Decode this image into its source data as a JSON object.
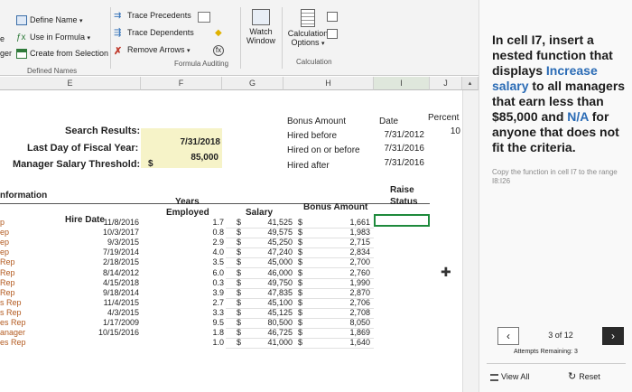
{
  "ribbon": {
    "define_name": "Define Name",
    "use_in_formula": "Use in Formula",
    "create_from_selection": "Create from Selection",
    "defined_names_group": "Defined Names",
    "trace_precedents": "Trace Precedents",
    "trace_dependents": "Trace Dependents",
    "remove_arrows": "Remove Arrows",
    "formula_auditing_group": "Formula Auditing",
    "watch_window_line1": "Watch",
    "watch_window_line2": "Window",
    "calc_options_line1": "Calculation",
    "calc_options_line2": "Options",
    "calculation_group": "Calculation",
    "left_edge_1": "e",
    "left_edge_2": "ger"
  },
  "columns": [
    "E",
    "F",
    "G",
    "H",
    "I",
    "J"
  ],
  "search": {
    "results_label": "Search Results:",
    "fiscal_label": "Last Day of Fiscal Year:",
    "fiscal_value": "7/31/2018",
    "threshold_label": "Manager Salary Threshold:",
    "threshold_currency": "$",
    "threshold_value": "85,000"
  },
  "bonus": {
    "header_amount": "Bonus Amount",
    "header_date": "Date",
    "header_percent": "Percent",
    "rows": [
      {
        "label": "Hired before",
        "date": "7/31/2012",
        "percent": "10"
      },
      {
        "label": "Hired on or before",
        "date": "7/31/2016",
        "percent": ""
      },
      {
        "label": "Hired after",
        "date": "7/31/2016",
        "percent": ""
      }
    ]
  },
  "table": {
    "section_label": "nformation",
    "hdr_hire": "Hire Date",
    "hdr_years_1": "Years",
    "hdr_years_2": "Employed",
    "hdr_salary": "Salary",
    "hdr_bonus": "Bonus Amount",
    "hdr_raise_1": "Raise",
    "hdr_raise_2": "Status",
    "rows": [
      {
        "pos": "p",
        "hire": "11/8/2016",
        "years": "1.7",
        "salary": "41,525",
        "bonus": "1,661"
      },
      {
        "pos": "ep",
        "hire": "10/3/2017",
        "years": "0.8",
        "salary": "49,575",
        "bonus": "1,983"
      },
      {
        "pos": "ep",
        "hire": "9/3/2015",
        "years": "2.9",
        "salary": "45,250",
        "bonus": "2,715"
      },
      {
        "pos": "ep",
        "hire": "7/19/2014",
        "years": "4.0",
        "salary": "47,240",
        "bonus": "2,834"
      },
      {
        "pos": "Rep",
        "hire": "2/18/2015",
        "years": "3.5",
        "salary": "45,000",
        "bonus": "2,700"
      },
      {
        "pos": "Rep",
        "hire": "8/14/2012",
        "years": "6.0",
        "salary": "46,000",
        "bonus": "2,760"
      },
      {
        "pos": "Rep",
        "hire": "4/15/2018",
        "years": "0.3",
        "salary": "49,750",
        "bonus": "1,990"
      },
      {
        "pos": "Rep",
        "hire": "9/18/2014",
        "years": "3.9",
        "salary": "47,835",
        "bonus": "2,870"
      },
      {
        "pos": "s Rep",
        "hire": "11/4/2015",
        "years": "2.7",
        "salary": "45,100",
        "bonus": "2,706"
      },
      {
        "pos": "s Rep",
        "hire": "4/3/2015",
        "years": "3.3",
        "salary": "45,125",
        "bonus": "2,708"
      },
      {
        "pos": "es Rep",
        "hire": "1/17/2009",
        "years": "9.5",
        "salary": "80,500",
        "bonus": "8,050"
      },
      {
        "pos": "anager",
        "hire": "10/15/2016",
        "years": "1.8",
        "salary": "46,725",
        "bonus": "1,869"
      },
      {
        "pos": "es Rep",
        "hire": "",
        "years": "1.0",
        "salary": "41,000",
        "bonus": "1,640"
      }
    ]
  },
  "panel": {
    "instr_pre": "In cell I7, insert a nested function that displays ",
    "instr_acc1": "Increase salary",
    "instr_mid": " to all managers that earn less than $85,000 and ",
    "instr_acc2": "N/A",
    "instr_post": " for anyone that does not fit the criteria.",
    "hint": "Copy the function in cell I7 to the range I8:I26",
    "page": "3 of 12",
    "attempts_label": "Attempts Remaining:",
    "attempts_value": "3",
    "view_all": "View All",
    "reset": "Reset"
  },
  "colors": {
    "highlight": "#f6f3c8",
    "accent": "#2a6bb5",
    "selection": "#1e8a3c"
  }
}
